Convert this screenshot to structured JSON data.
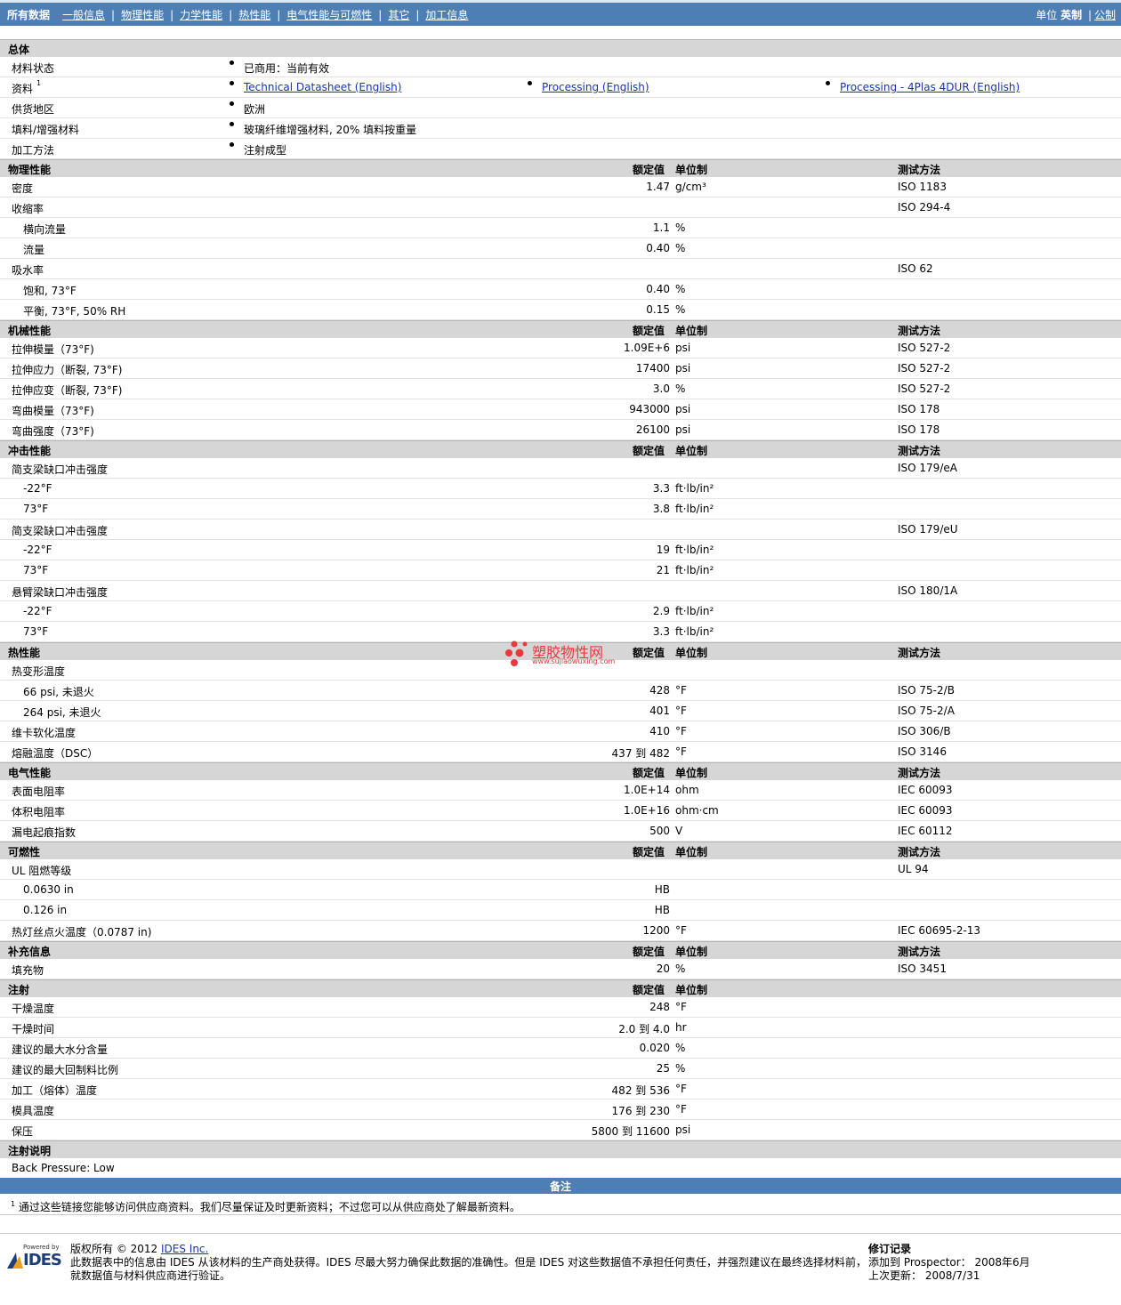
{
  "topbar": {
    "tabs": [
      "所有数据",
      "一般信息",
      "物理性能",
      "力学性能",
      "热性能",
      "电气性能与可燃性",
      "其它",
      "加工信息"
    ],
    "units_label": "单位",
    "units_selected": "英制",
    "units_other": "公制"
  },
  "headers": {
    "nominal": "额定值",
    "unit": "单位制",
    "test": "测试方法"
  },
  "general": {
    "title": "总体",
    "rows": [
      {
        "label": "材料状态",
        "value": "已商用：当前有效"
      },
      {
        "label": "资料",
        "sup": "1",
        "links": [
          "Technical Datasheet (English)",
          "Processing (English)",
          "Processing - 4Plas 4DUR (English)"
        ]
      },
      {
        "label": "供货地区",
        "value": "欧洲"
      },
      {
        "label": "填料/增强材料",
        "value": "玻璃纤维增强材料, 20% 填料按重量"
      },
      {
        "label": "加工方法",
        "value": "注射成型"
      }
    ]
  },
  "sections": [
    {
      "title": "物理性能",
      "rows": [
        {
          "label": "密度",
          "value": "1.47",
          "unit": "g/cm³",
          "test": "ISO 1183"
        },
        {
          "label": "收缩率",
          "value": "",
          "unit": "",
          "test": "ISO 294-4"
        },
        {
          "label": "横向流量",
          "value": "1.1",
          "unit": "%",
          "test": "",
          "sub": true
        },
        {
          "label": "流量",
          "value": "0.40",
          "unit": "%",
          "test": "",
          "sub": true
        },
        {
          "label": "吸水率",
          "value": "",
          "unit": "",
          "test": "ISO 62"
        },
        {
          "label": "饱和, 73°F",
          "value": "0.40",
          "unit": "%",
          "test": "",
          "sub": true
        },
        {
          "label": "平衡, 73°F, 50% RH",
          "value": "0.15",
          "unit": "%",
          "test": "",
          "sub": true
        }
      ]
    },
    {
      "title": "机械性能",
      "rows": [
        {
          "label": "拉伸模量（73°F)",
          "value": "1.09E+6",
          "unit": "psi",
          "test": "ISO 527-2"
        },
        {
          "label": "拉伸应力（断裂, 73°F)",
          "value": "17400",
          "unit": "psi",
          "test": "ISO 527-2"
        },
        {
          "label": "拉伸应变（断裂, 73°F)",
          "value": "3.0",
          "unit": "%",
          "test": "ISO 527-2"
        },
        {
          "label": "弯曲模量（73°F)",
          "value": "943000",
          "unit": "psi",
          "test": "ISO 178"
        },
        {
          "label": "弯曲强度（73°F)",
          "value": "26100",
          "unit": "psi",
          "test": "ISO 178"
        }
      ]
    },
    {
      "title": "冲击性能",
      "rows": [
        {
          "label": "简支梁缺口冲击强度",
          "value": "",
          "unit": "",
          "test": "ISO 179/eA"
        },
        {
          "label": "-22°F",
          "value": "3.3",
          "unit": "ft·lb/in²",
          "test": "",
          "sub": true
        },
        {
          "label": "73°F",
          "value": "3.8",
          "unit": "ft·lb/in²",
          "test": "",
          "sub": true
        },
        {
          "label": "简支梁缺口冲击强度",
          "value": "",
          "unit": "",
          "test": "ISO 179/eU"
        },
        {
          "label": "-22°F",
          "value": "19",
          "unit": "ft·lb/in²",
          "test": "",
          "sub": true
        },
        {
          "label": "73°F",
          "value": "21",
          "unit": "ft·lb/in²",
          "test": "",
          "sub": true
        },
        {
          "label": "悬臂梁缺口冲击强度",
          "value": "",
          "unit": "",
          "test": "ISO 180/1A"
        },
        {
          "label": "-22°F",
          "value": "2.9",
          "unit": "ft·lb/in²",
          "test": "",
          "sub": true
        },
        {
          "label": "73°F",
          "value": "3.3",
          "unit": "ft·lb/in²",
          "test": "",
          "sub": true
        }
      ]
    },
    {
      "title": "热性能",
      "rows": [
        {
          "label": "热变形温度",
          "value": "",
          "unit": "",
          "test": ""
        },
        {
          "label": "66 psi, 未退火",
          "value": "428",
          "unit": "°F",
          "test": "ISO 75-2/B",
          "sub": true
        },
        {
          "label": "264 psi, 未退火",
          "value": "401",
          "unit": "°F",
          "test": "ISO 75-2/A",
          "sub": true
        },
        {
          "label": "维卡软化温度",
          "value": "410",
          "unit": "°F",
          "test": "ISO 306/B"
        },
        {
          "label": "熔融温度（DSC）",
          "value": "437 到  482",
          "unit": "°F",
          "test": "ISO 3146"
        }
      ]
    },
    {
      "title": "电气性能",
      "rows": [
        {
          "label": "表面电阻率",
          "value": "1.0E+14",
          "unit": "ohm",
          "test": "IEC 60093"
        },
        {
          "label": "体积电阻率",
          "value": "1.0E+16",
          "unit": "ohm·cm",
          "test": "IEC 60093"
        },
        {
          "label": "漏电起痕指数",
          "value": "500",
          "unit": "V",
          "test": "IEC 60112"
        }
      ]
    },
    {
      "title": "可燃性",
      "rows": [
        {
          "label": "UL 阻燃等级",
          "value": "",
          "unit": "",
          "test": "UL 94"
        },
        {
          "label": "0.0630 in",
          "value": "HB",
          "unit": "",
          "test": "",
          "sub": true
        },
        {
          "label": "0.126 in",
          "value": "HB",
          "unit": "",
          "test": "",
          "sub": true
        },
        {
          "label": "热灯丝点火温度（0.0787 in)",
          "value": "1200",
          "unit": "°F",
          "test": "IEC 60695-2-13"
        }
      ]
    },
    {
      "title": "补充信息",
      "rows": [
        {
          "label": "填充物",
          "value": "20",
          "unit": "%",
          "test": "ISO 3451"
        }
      ]
    },
    {
      "title": "注射",
      "noTest": true,
      "rows": [
        {
          "label": "干燥温度",
          "value": "248",
          "unit": "°F",
          "test": ""
        },
        {
          "label": "干燥时间",
          "value": "2.0 到  4.0",
          "unit": "hr",
          "test": ""
        },
        {
          "label": "建议的最大水分含量",
          "value": "0.020",
          "unit": "%",
          "test": ""
        },
        {
          "label": "建议的最大回制料比例",
          "value": "25",
          "unit": "%",
          "test": ""
        },
        {
          "label": "加工（熔体）温度",
          "value": "482 到  536",
          "unit": "°F",
          "test": ""
        },
        {
          "label": "模具温度",
          "value": "176 到  230",
          "unit": "°F",
          "test": ""
        },
        {
          "label": "保压",
          "value": "5800 到  11600",
          "unit": "psi",
          "test": ""
        }
      ]
    },
    {
      "title": "注射说明",
      "noHeaders": true,
      "rows": [
        {
          "label": "Back Pressure: Low",
          "value": "",
          "unit": "",
          "test": "",
          "plain": true
        }
      ]
    }
  ],
  "notes": {
    "title": "备注",
    "footnote_num": "1",
    "footnote": "通过这些链接您能够访问供应商资料。我们尽量保证及时更新资料；不过您可以从供应商处了解最新资料。"
  },
  "footer": {
    "powered": "Powered by",
    "logo": "IDES",
    "copyright_prefix": "版权所有 © 2012 ",
    "company": "IDES Inc.",
    "line2": "此数据表中的信息由 IDES 从该材料的生产商处获得。IDES 尽最大努力确保此数据的准确性。但是 IDES 对这些数据值不承担任何责任，并强烈建议在最终选择材料前，",
    "line3": "就数据值与材料供应商进行验证。",
    "rev_title": "修订记录",
    "added": "添加到 Prospector：  2008年6月",
    "updated": "上次更新：  2008/7/31"
  },
  "watermark": {
    "text": "塑胶物性网",
    "url": "www.sujiaowuxing.com"
  }
}
